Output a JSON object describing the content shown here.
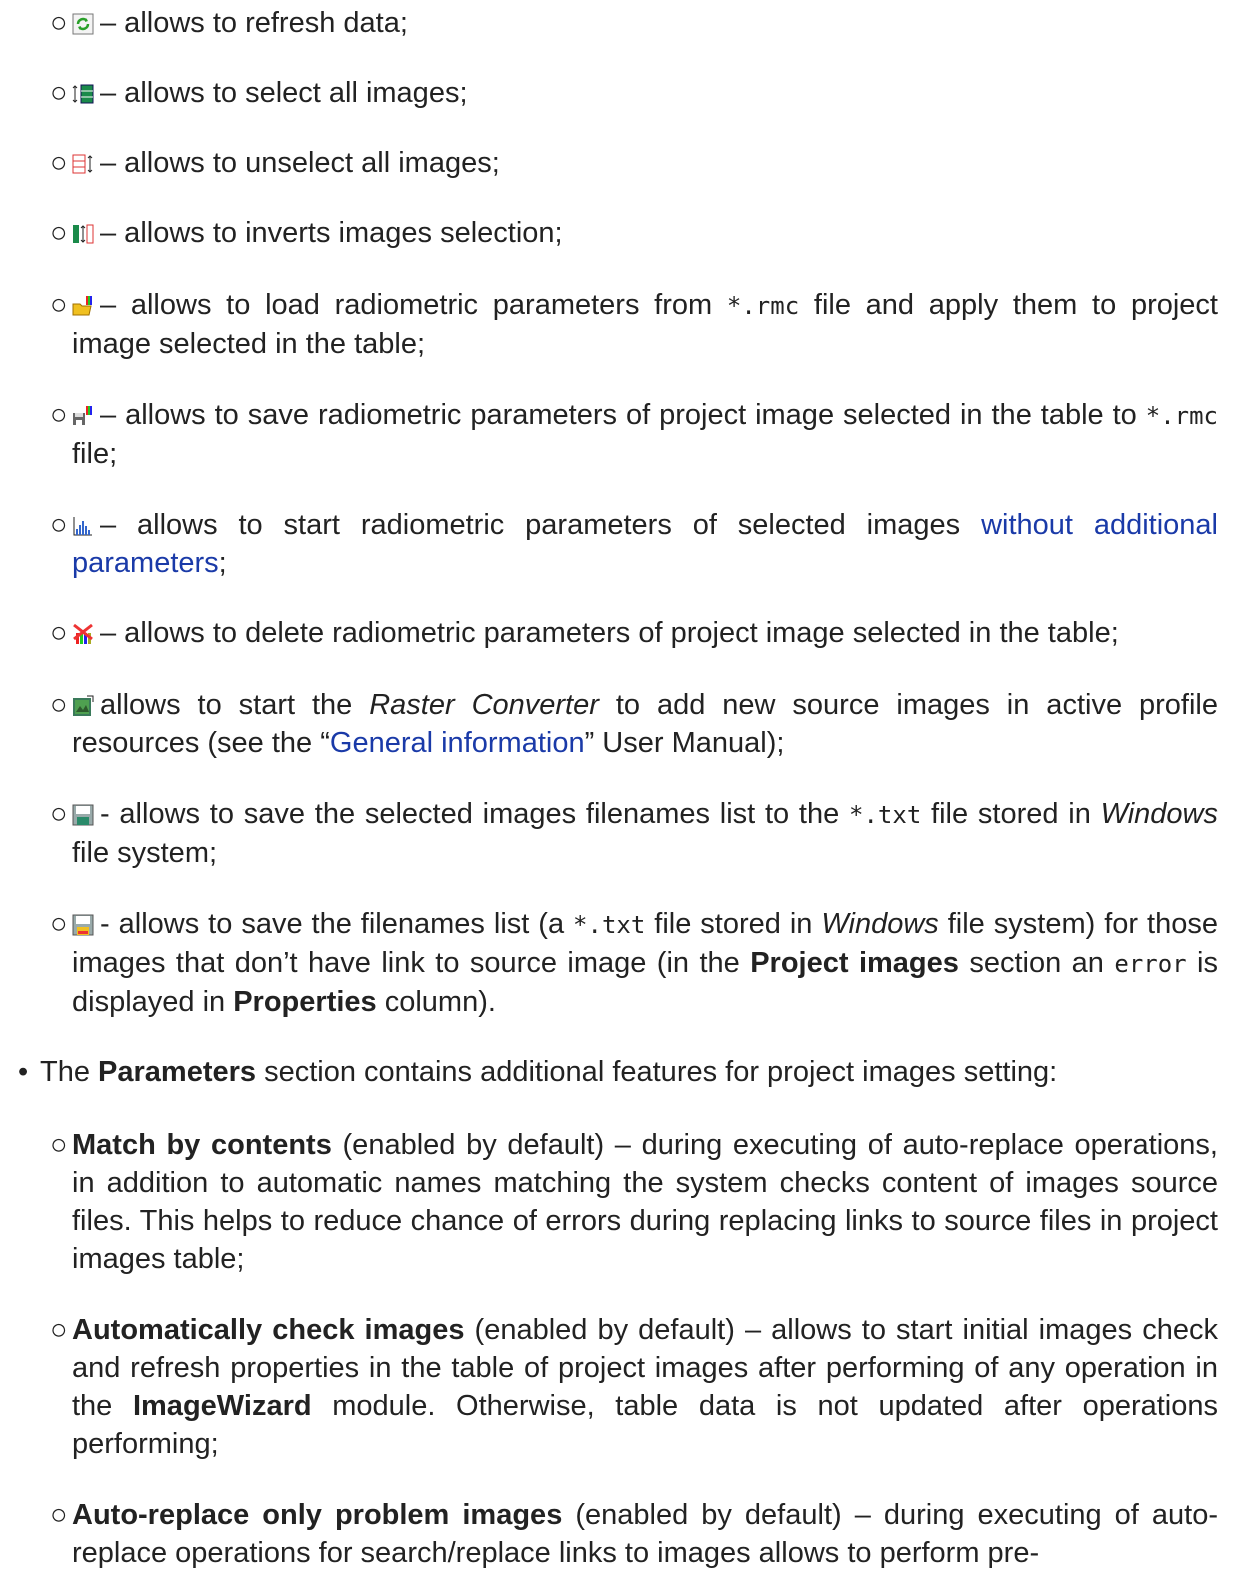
{
  "bullets": {
    "hollow": "○",
    "solid": "•"
  },
  "items": {
    "refresh": {
      "text": "– allows to refresh data;"
    },
    "select_all": {
      "text": "– allows to select all images;"
    },
    "unselect_all": {
      "text": "– allows to unselect all images;"
    },
    "invert": {
      "text": "– allows to inverts images selection;"
    },
    "load_rmc": {
      "a": "– allows to load radiometric parameters from ",
      "code": "*.rmc",
      "b": " file and apply them to project image selected in the table;"
    },
    "save_rmc": {
      "a": "– allows to save radiometric parameters of project image selected in the table to ",
      "code": "*.rmc",
      "b": " file;"
    },
    "start_radiometric": {
      "a": "– allows to start radiometric parameters of selected images ",
      "link": "without additional parameters",
      "b": ";"
    },
    "delete_radiometric": {
      "text": "– allows to delete radiometric parameters of project image selected in the table;"
    },
    "raster_converter": {
      "a": "allows to start the ",
      "em": "Raster Converter",
      "b": " to add new source images in active profile resources (see the “",
      "link": "General information",
      "c": "” User Manual);"
    },
    "save_selected_list": {
      "a": "- allows to save the selected images filenames list to the ",
      "code": "*.txt",
      "b": " file stored in ",
      "em": "Windows",
      "c": " file system;"
    },
    "save_problem_list": {
      "a": "- allows to save the filenames list (a ",
      "code": "*.txt",
      "b": " file stored in ",
      "em": "Windows",
      "c": " file system) for those images that don’t have link to source image (in the ",
      "bold1": "Project images",
      "d": " section an ",
      "code2": "error",
      "e": " is displayed in ",
      "bold2": "Properties",
      "f": " column)."
    }
  },
  "parameters": {
    "a": "The ",
    "bold": "Parameters",
    "b": " section contains additional features for project images setting:",
    "match": {
      "bold": "Match by contents",
      "text": " (enabled by default) – during executing of auto-replace operations, in addition to automatic names matching the system checks content of images source files. This helps to reduce chance of errors during replacing links to source files in project images table;"
    },
    "auto_check": {
      "bold": "Automatically check images",
      "a": " (enabled by default) – allows to start initial images check and refresh properties in the table of project images after performing of any operation in the ",
      "bold2": "ImageWizard",
      "b": " module. Otherwise, table data is not updated after operations performing;"
    },
    "auto_replace": {
      "bold": "Auto-replace only problem images",
      "text": " (enabled by default) – during executing of auto-replace operations for search/replace links to images allows to perform pre-"
    }
  },
  "colors": {
    "link": "#1a3aa8",
    "text": "#222222"
  },
  "icons": [
    "refresh-icon",
    "select-all-icon",
    "unselect-all-icon",
    "invert-selection-icon",
    "load-rmc-icon",
    "save-rmc-icon",
    "radiometric-start-icon",
    "delete-radiometric-icon",
    "raster-converter-icon",
    "save-list-icon",
    "save-problem-list-icon"
  ]
}
